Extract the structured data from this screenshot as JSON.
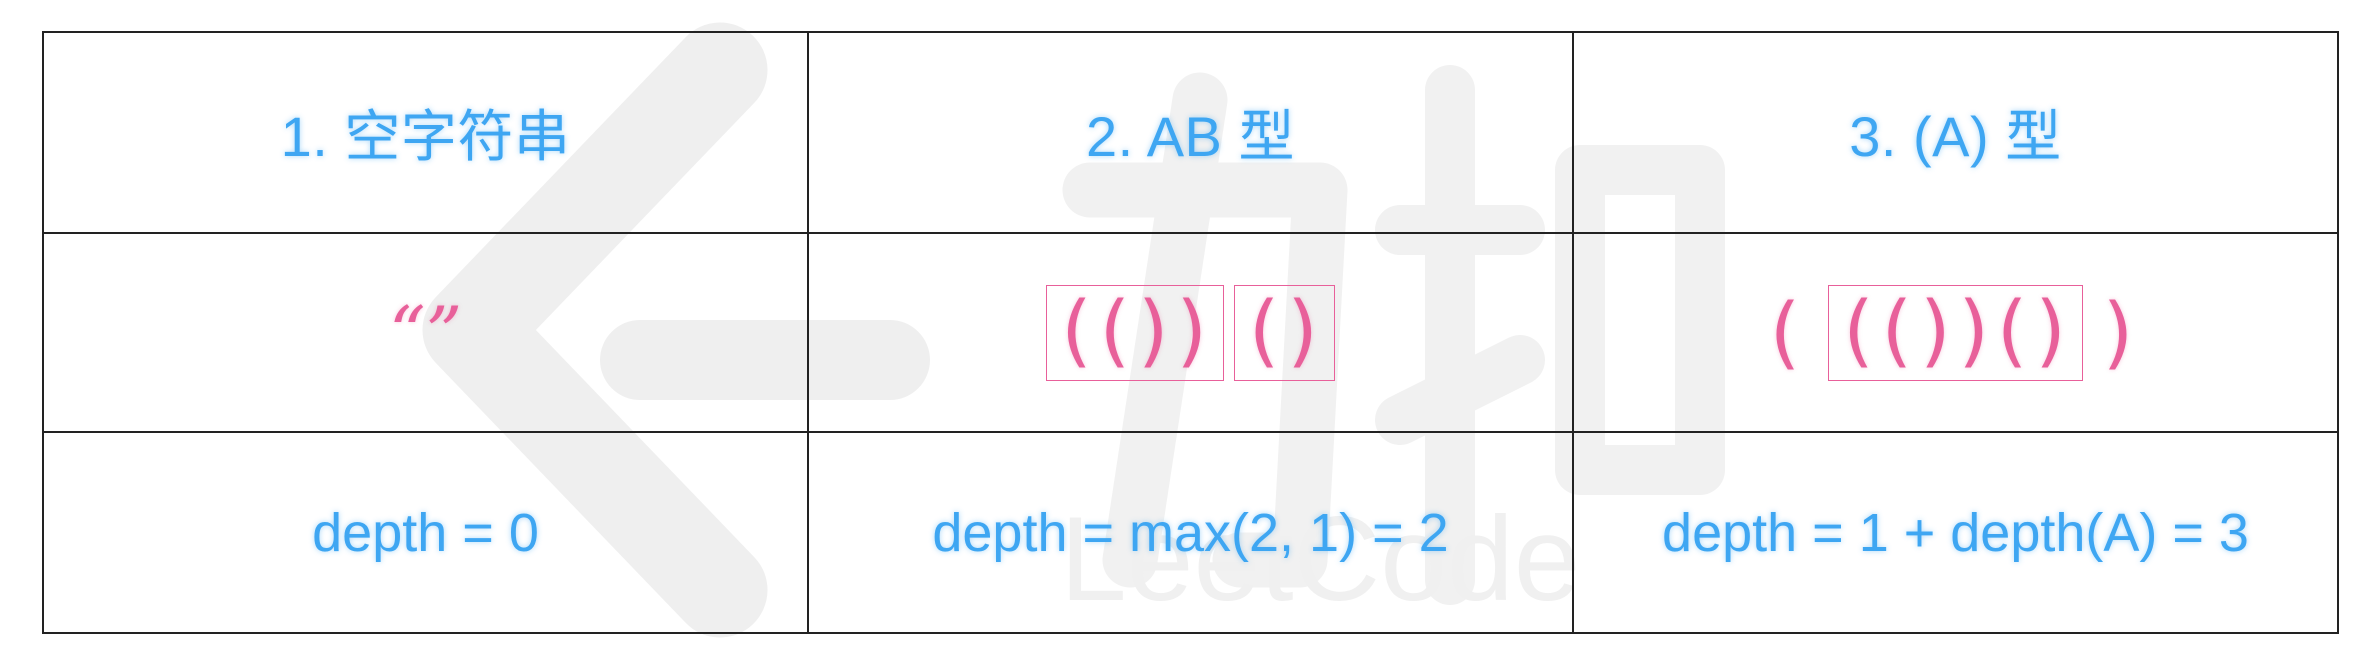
{
  "watermark": {
    "text": "LeetCode"
  },
  "headers": [
    "1. 空字符串",
    "2. AB 型",
    "3. (A) 型"
  ],
  "examples": {
    "empty": "“”",
    "ab_part_a": "(())",
    "ab_part_b": "()",
    "wrap_left": "(",
    "wrap_inner": "(())()",
    "wrap_right": ")"
  },
  "formulas": [
    "depth = 0",
    "depth = max(2, 1) = 2",
    "depth = 1 + depth(A) = 3"
  ],
  "colors": {
    "text_blue": "#3ea6f2",
    "paren_pink": "#e8609a",
    "watermark_gray": "#ececec"
  }
}
